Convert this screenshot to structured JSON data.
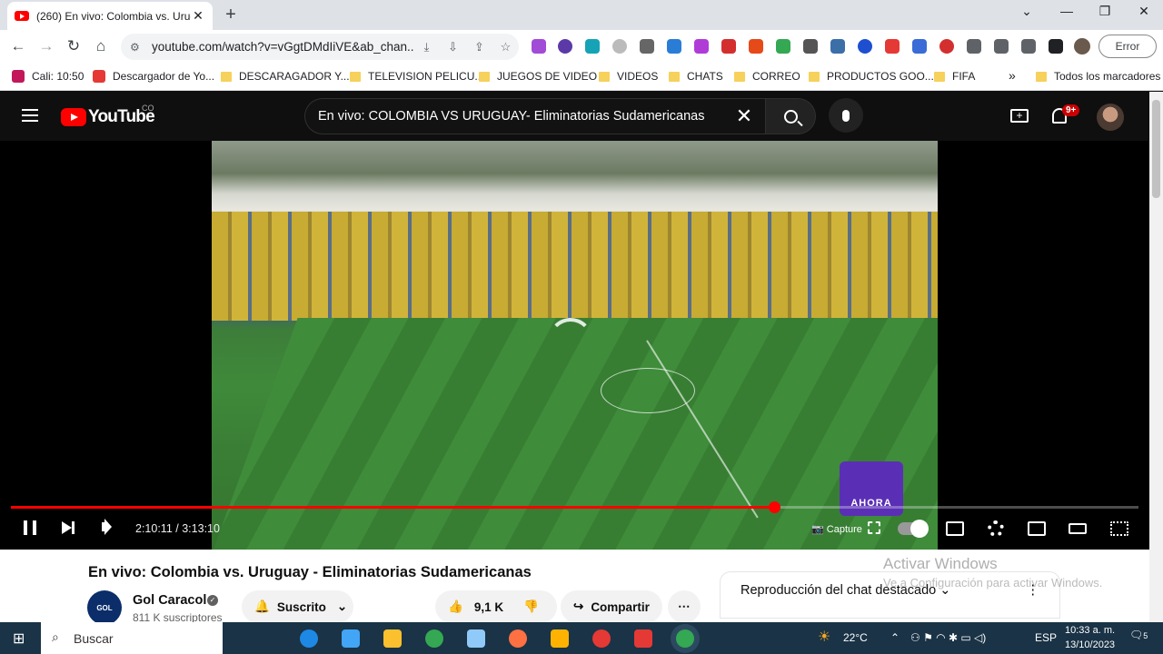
{
  "browser": {
    "tab_title": "(260) En vivo: Colombia vs. Urug",
    "url": "youtube.com/watch?v=vGgtDMdIiVE&ab_chan...",
    "error_label": "Error"
  },
  "bookmarks": [
    {
      "label": "Cali: 10:50",
      "icon": "clock-icon",
      "color": "#c2185b"
    },
    {
      "label": "Descargador de Yo...",
      "icon": "download-icon",
      "color": "#e53935"
    },
    {
      "label": "DESCARAGADOR Y...",
      "icon": "folder-icon"
    },
    {
      "label": "TELEVISION PELICU...",
      "icon": "folder-icon"
    },
    {
      "label": "JUEGOS DE VIDEO",
      "icon": "folder-icon"
    },
    {
      "label": "VIDEOS",
      "icon": "folder-icon"
    },
    {
      "label": "CHATS",
      "icon": "folder-icon"
    },
    {
      "label": "CORREO",
      "icon": "folder-icon"
    },
    {
      "label": "PRODUCTOS GOO...",
      "icon": "folder-icon"
    },
    {
      "label": "FIFA",
      "icon": "folder-icon"
    }
  ],
  "bookmarks_overflow": "»",
  "all_bookmarks": "Todos los marcadores",
  "youtube": {
    "logo": "YouTube",
    "country": "CO",
    "search_query": "En vivo: COLOMBIA VS URUGUAY- Eliminatorias Sudamericanas",
    "notif_badge": "9+"
  },
  "player": {
    "current_time": "2:10:11",
    "separator": "/",
    "duration": "3:13:10",
    "progress": 0.677,
    "capture_label": "Capture",
    "overlay_label": "AHORA"
  },
  "video": {
    "title": "En vivo: Colombia vs. Uruguay - Eliminatorias Sudamericanas",
    "channel": "Gol Caracol",
    "channel_avatar": "GOL",
    "subscribers": "811 K suscriptores",
    "subscribe_label": "Suscrito",
    "likes": "9,1 K",
    "share_label": "Compartir",
    "chat_label": "Reproducción del chat destacado"
  },
  "watermark": {
    "line1": "Activar Windows",
    "line2": "Ve a Configuración para activar Windows."
  },
  "taskbar": {
    "search_label": "Buscar",
    "temperature": "22°C",
    "language": "ESP",
    "time": "10:33 a. m.",
    "date": "13/10/2023",
    "notifications": "5"
  },
  "colors": {
    "accent": "#ff0000",
    "youtube_bg": "#0f0f0f",
    "taskbar": "#1a3346"
  }
}
